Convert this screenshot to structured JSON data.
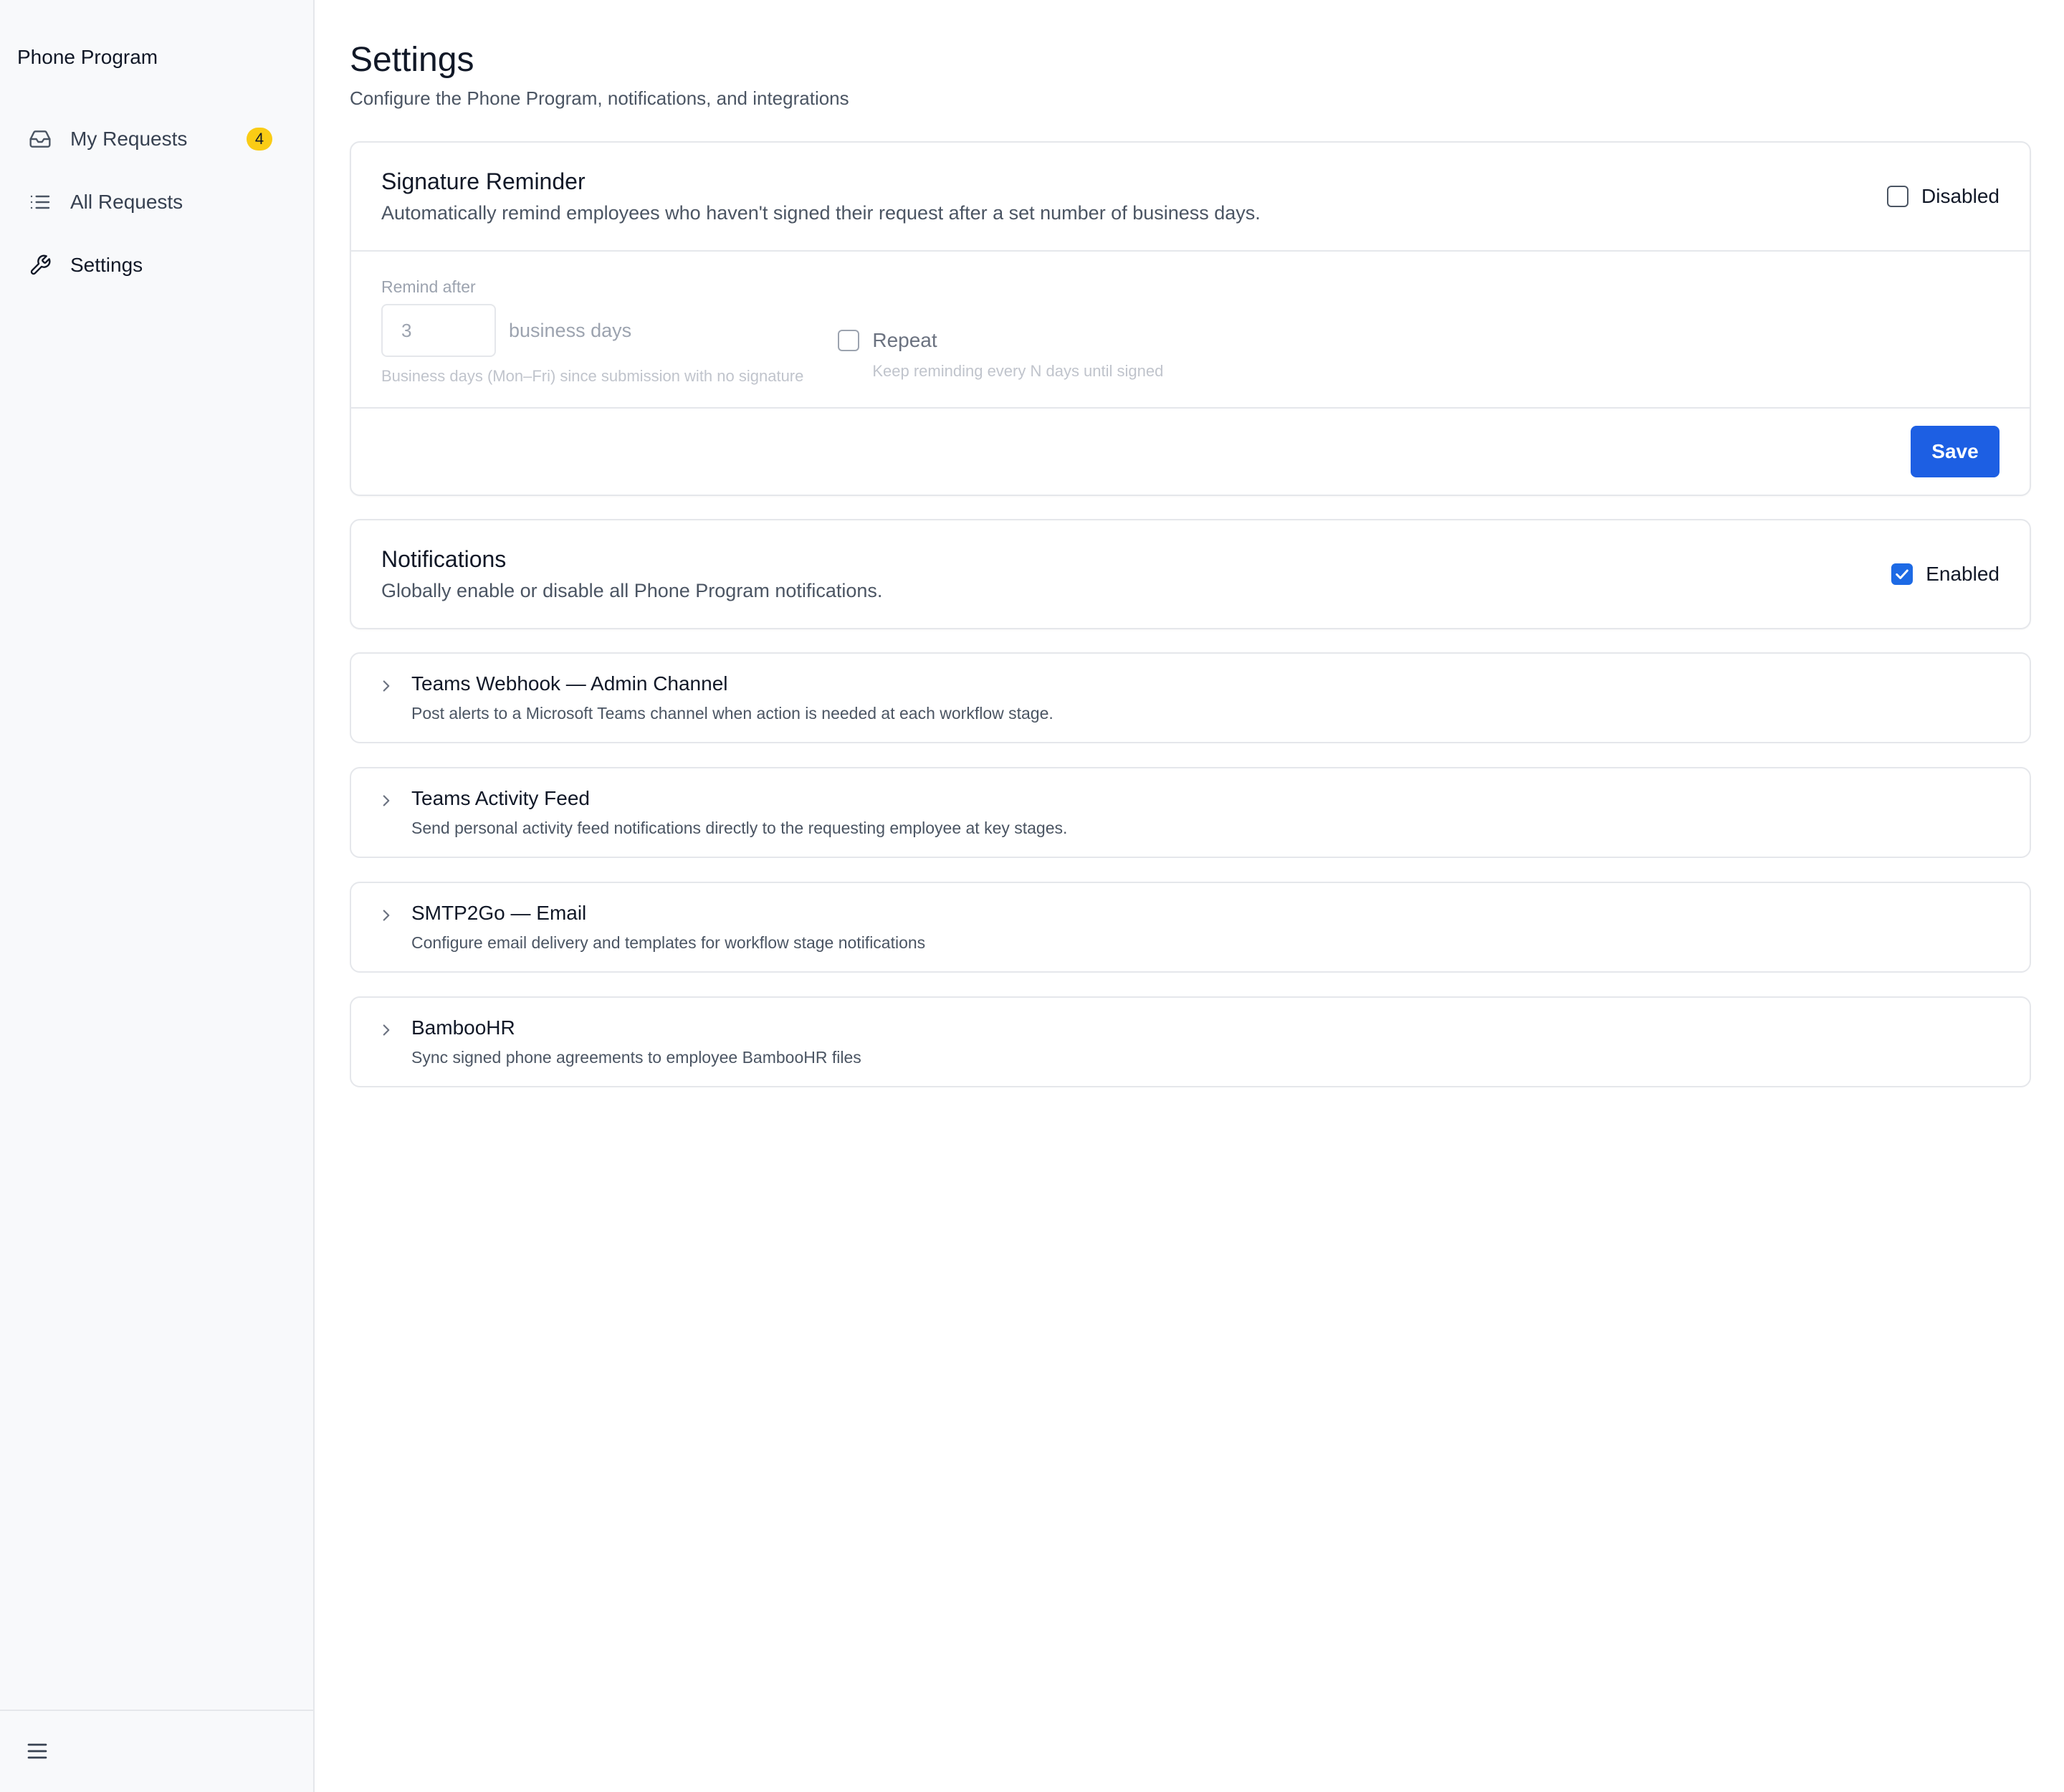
{
  "app": {
    "title": "Phone Program"
  },
  "sidebar": {
    "items": [
      {
        "label": "My Requests",
        "icon": "inbox-icon",
        "badge": "4"
      },
      {
        "label": "All Requests",
        "icon": "list-icon"
      },
      {
        "label": "Settings",
        "icon": "wrench-icon",
        "active": true
      }
    ],
    "footer_icon": "menu-icon"
  },
  "page": {
    "title": "Settings",
    "subtitle": "Configure the Phone Program, notifications, and integrations"
  },
  "signature_reminder": {
    "title": "Signature Reminder",
    "description": "Automatically remind employees who haven't signed their request after a set number of business days.",
    "toggle_label": "Disabled",
    "enabled": false,
    "remind_after_label": "Remind after",
    "remind_after_value": "3",
    "unit": "business days",
    "remind_hint": "Business days (Mon–Fri) since submission with no signature",
    "repeat_label": "Repeat",
    "repeat_checked": false,
    "repeat_hint": "Keep reminding every N days until signed",
    "save_label": "Save"
  },
  "notifications": {
    "title": "Notifications",
    "description": "Globally enable or disable all Phone Program notifications.",
    "toggle_label": "Enabled",
    "enabled": true
  },
  "integrations": [
    {
      "title": "Teams Webhook — Admin Channel",
      "description": "Post alerts to a Microsoft Teams channel when action is needed at each workflow stage."
    },
    {
      "title": "Teams Activity Feed",
      "description": "Send personal activity feed notifications directly to the requesting employee at key stages."
    },
    {
      "title": "SMTP2Go — Email",
      "description": "Configure email delivery and templates for workflow stage notifications"
    },
    {
      "title": "BambooHR",
      "description": "Sync signed phone agreements to employee BambooHR files"
    }
  ],
  "colors": {
    "accent": "#1d5fe3",
    "badge": "#facc15",
    "sidebar_bg": "#f8f9fb",
    "border": "#e5e7eb"
  }
}
